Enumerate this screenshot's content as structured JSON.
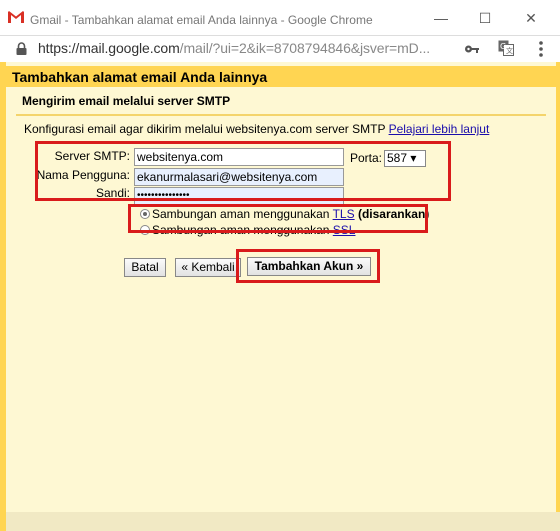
{
  "window": {
    "title": "Gmail - Tambahkan alamat email Anda lainnya - Google Chrome",
    "minimize": "—",
    "maximize": "☐",
    "close": "✕"
  },
  "address_bar": {
    "url_main": "https://mail.google.com",
    "url_rest": "/mail/?ui=2&ik=8708794846&jsver=mD..."
  },
  "dialog": {
    "title": "Tambahkan alamat email Anda lainnya",
    "subtitle": "Mengirim email melalui server SMTP",
    "description": "Konfigurasi email agar dikirim melalui websitenya.com server SMTP ",
    "learn_more": "Pelajari lebih lanjut",
    "smtp_label": "Server SMTP:",
    "smtp_value": "websitenya.com",
    "port_label": "Porta:",
    "port_value": "587 ▾",
    "username_label": "Nama Pengguna:",
    "username_value": "ekanurmalasari@websitenya.com",
    "password_label": "Sandi:",
    "password_value": "•••••••••••••••",
    "tls_text": "Sambungan aman menggunakan ",
    "tls_link": "TLS",
    "tls_note": " (disarankan)",
    "ssl_text": "Sambungan aman menggunakan ",
    "ssl_link": "SSL",
    "cancel_button": "Batal",
    "back_button": "« Kembali",
    "add_button": "Tambahkan Akun »"
  },
  "colors": {
    "header_yellow": "#ffd552",
    "page_bg": "#fef8d3",
    "highlight_red": "#d91b1b",
    "link_blue": "#1a0dab"
  }
}
